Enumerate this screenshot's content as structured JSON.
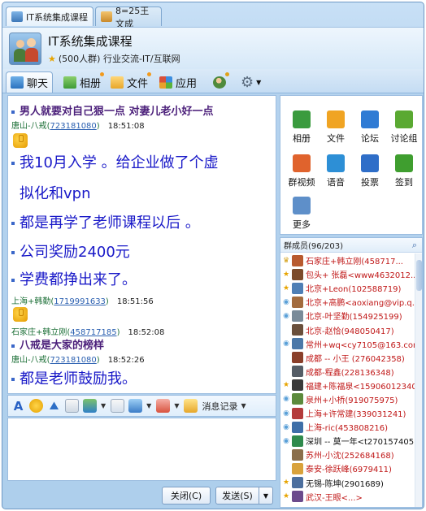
{
  "tabs": [
    {
      "label": "IT系统集成课程",
      "active": true
    },
    {
      "label": "8=25王文成",
      "active": false
    }
  ],
  "header": {
    "title": "IT系统集成课程",
    "info": "(500人群) 行业交流-IT/互联网"
  },
  "nav": {
    "chat": "聊天",
    "album": "相册",
    "file": "文件",
    "app": "应用"
  },
  "messages": [
    {
      "type": "text-small",
      "text": "男人就要对自己狠一点  对妻儿老小好一点"
    },
    {
      "type": "sender",
      "name": "唐山-八戒",
      "id": "723181080",
      "time": "18:51:08"
    },
    {
      "type": "thumb"
    },
    {
      "type": "text-big",
      "text": "我10月入学 。给企业做了个虚"
    },
    {
      "type": "text-big-cont",
      "text": "拟化和vpn"
    },
    {
      "type": "text-big",
      "text": "都是再学了老师课程以后 。"
    },
    {
      "type": "text-big",
      "text": "公司奖励2400元"
    },
    {
      "type": "text-big",
      "text": "学费都挣出来了。"
    },
    {
      "type": "sender",
      "name": "上海+韩勤",
      "id": "1719991633",
      "time": "18:51:56"
    },
    {
      "type": "thumb"
    },
    {
      "type": "sender",
      "name": "石家庄+韩立刚",
      "id": "458717185",
      "time": "18:52:08"
    },
    {
      "type": "text-small",
      "text": "八戒是大家的榜样"
    },
    {
      "type": "sender",
      "name": "唐山-八戒",
      "id": "723181080",
      "time": "18:52:26"
    },
    {
      "type": "text-big",
      "text": "都是老师鼓励我。"
    }
  ],
  "toolbar": {
    "history_label": "消息记录"
  },
  "buttons": {
    "close": "关闭(C)",
    "send": "发送(S)"
  },
  "apps": [
    {
      "label": "相册",
      "color": "#3a9b3e"
    },
    {
      "label": "文件",
      "color": "#f0a423"
    },
    {
      "label": "论坛",
      "color": "#2f7bd4"
    },
    {
      "label": "讨论组",
      "color": "#5aa932"
    },
    {
      "label": "群视频",
      "color": "#e0632d"
    },
    {
      "label": "语音",
      "color": "#2d8fd6"
    },
    {
      "label": "投票",
      "color": "#2f6ec8"
    },
    {
      "label": "签到",
      "color": "#3f9e2f"
    },
    {
      "label": "更多",
      "color": "#5e8fc9"
    }
  ],
  "members_header": "群成员(96/203)",
  "members": [
    {
      "name": "石家庄+韩立刚(458717...",
      "role": "owner",
      "red": true,
      "av": "#b85a2f"
    },
    {
      "name": "包头+ 张磊<www4632012...",
      "role": "admin",
      "red": true,
      "av": "#7c4b2b"
    },
    {
      "name": "北京+Leon(102588719)",
      "role": "admin",
      "red": true,
      "av": "#4f7fb5"
    },
    {
      "name": "北京+高鹏<aoxiang@vip.q...",
      "role": "msg",
      "red": true,
      "av": "#a36b3d"
    },
    {
      "name": "北京-叶坚勤(154925199)",
      "role": "msg",
      "red": true,
      "av": "#7a8b99"
    },
    {
      "name": "北京-赵恰(948050417)",
      "role": "none",
      "red": true,
      "av": "#6a4f3b"
    },
    {
      "name": "常州+wq<cy7105@163.com>",
      "role": "msg",
      "red": true,
      "av": "#4b78a8"
    },
    {
      "name": "成都 -- 小王 (276042358)",
      "role": "none",
      "red": true,
      "av": "#8a3f2a"
    },
    {
      "name": "成都-程鑫(228136348)",
      "role": "none",
      "red": true,
      "av": "#555d66"
    },
    {
      "name": "福建+陈福泉<15906012340>",
      "role": "admin",
      "red": true,
      "av": "#3a3a3a"
    },
    {
      "name": "泉州+小桥(919075975)",
      "role": "msg",
      "red": true,
      "av": "#5c8a3c"
    },
    {
      "name": "上海+许常建(339031241)",
      "role": "msg",
      "red": true,
      "av": "#b43b3b"
    },
    {
      "name": "上海-ric(453808216)",
      "role": "msg",
      "red": true,
      "av": "#3e6fa8"
    },
    {
      "name": "深圳 -- 莫一年<t270157405...",
      "role": "msg",
      "red": false,
      "av": "#2f8a4c"
    },
    {
      "name": "苏州-小沈(252684168)",
      "role": "none",
      "red": true,
      "av": "#8a6e4b"
    },
    {
      "name": "泰安-徐跃峰(6979411)",
      "role": "none",
      "red": true,
      "av": "#d9a23b"
    },
    {
      "name": "无锡-陈坤(2901689)",
      "role": "admin",
      "red": false,
      "av": "#4c6f9e"
    },
    {
      "name": "武汉-王眼<...>",
      "role": "admin",
      "red": true,
      "av": "#6b4a8c"
    }
  ]
}
